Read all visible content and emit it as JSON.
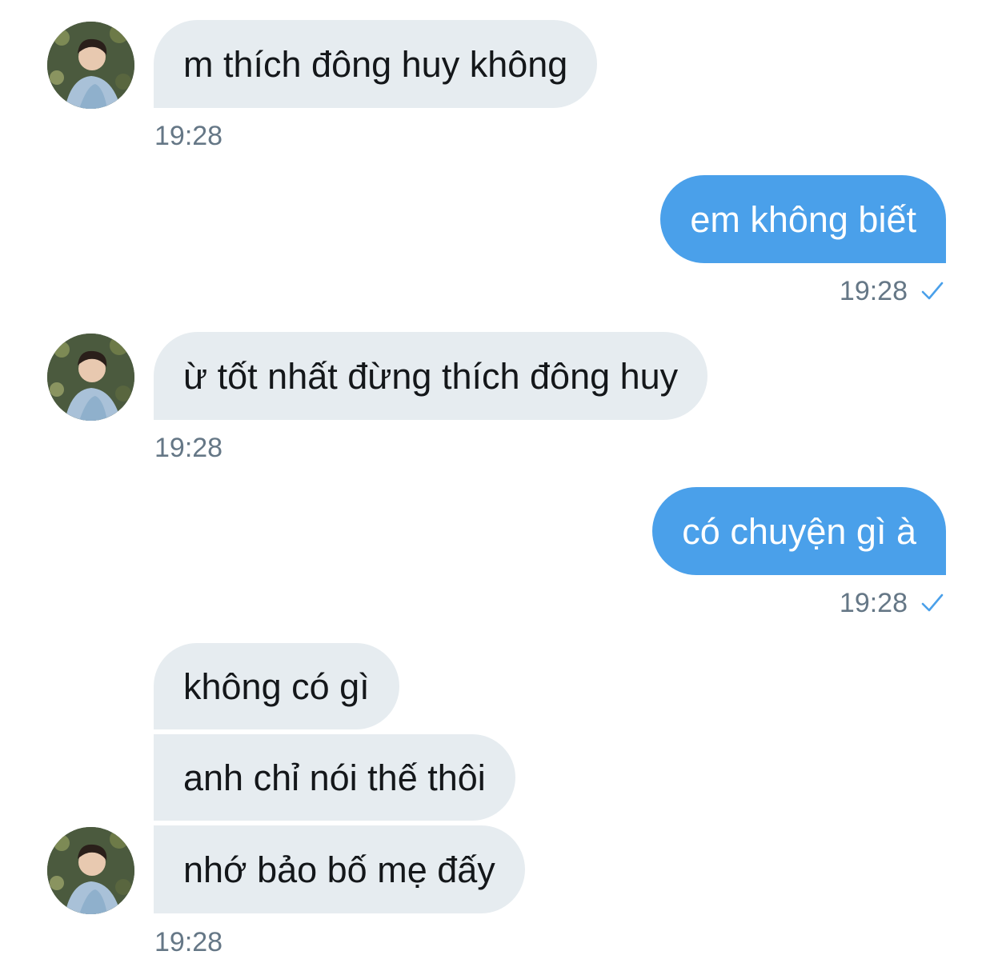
{
  "messages": [
    {
      "side": "received",
      "text": "m thích đông huy không",
      "time": "19:28"
    },
    {
      "side": "sent",
      "text": "em không biết",
      "time": "19:28",
      "status": "check-icon"
    },
    {
      "side": "received",
      "text": "ừ tốt nhất đừng thích đông huy",
      "time": "19:28"
    },
    {
      "side": "sent",
      "text": "có chuyện gì à",
      "time": "19:28",
      "status": "check-icon"
    },
    {
      "side": "received",
      "text": "không có gì"
    },
    {
      "side": "received",
      "text": "anh chỉ nói thế thôi"
    },
    {
      "side": "received",
      "text": "nhớ bảo bố mẹ đấy",
      "time": "19:28"
    }
  ],
  "colors": {
    "received_bubble": "#e6ecf0",
    "sent_bubble": "#4aa0ea",
    "timestamp": "#657786",
    "check": "#4aa0ea"
  },
  "icons": {
    "avatar": "user-avatar-photo",
    "read_receipt": "check-icon"
  }
}
